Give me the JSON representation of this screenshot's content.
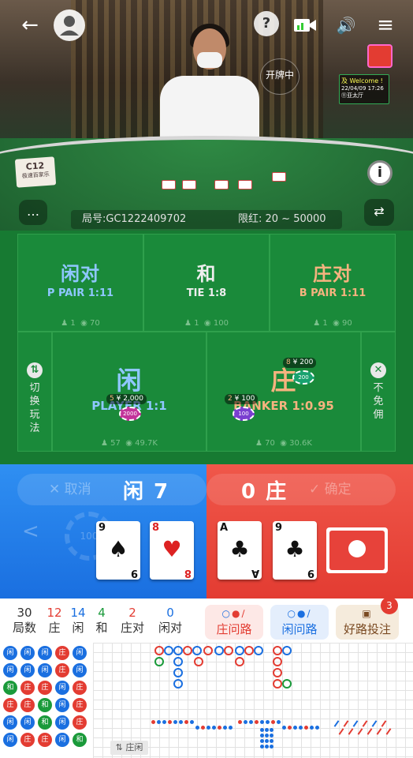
{
  "header": {
    "dealing_label": "开牌中",
    "welcome_line1": "及 Welcome !",
    "welcome_line2": "22/04/09  17:26",
    "welcome_line3": "⑪亚太厅"
  },
  "table_sign": {
    "code": "C12",
    "name": "极速百家乐"
  },
  "round_bar": {
    "round": "局号:GC1222409702",
    "limit": "限红: 20 ~ 50000"
  },
  "bets": {
    "player_pair": {
      "title": "闲对",
      "odds": "P PAIR 1:11",
      "players": "1",
      "amount": "70"
    },
    "tie": {
      "title": "和",
      "odds": "TIE 1:8",
      "players": "1",
      "amount": "100"
    },
    "banker_pair": {
      "title": "庄对",
      "odds": "B PAIR 1:11",
      "players": "1",
      "amount": "90"
    },
    "player": {
      "title": "闲",
      "odds": "PLAYER 1:1",
      "players": "57",
      "amount": "49.7K",
      "chip_tag": "¥ 2,000",
      "chip_count": "5",
      "chip_value": "2000"
    },
    "banker": {
      "title": "庄",
      "odds": "BANKER 1:0.95",
      "players": "70",
      "amount": "30.6K",
      "chip_tag1": "¥ 200",
      "chip_count1": "8",
      "chip_value1": "200",
      "chip_tag2": "¥ 100",
      "chip_count2": "2",
      "chip_value2": "100"
    },
    "switch_label": "切换玩法",
    "nocomm_label": "不免佣"
  },
  "result": {
    "cancel": "取消",
    "confirm": "确定",
    "player_label": "闲 7",
    "banker_label": "0 庄",
    "player_cards": [
      {
        "rank": "9",
        "suit": "♠",
        "color": "black"
      },
      {
        "rank": "8",
        "suit": "♥",
        "color": "red"
      }
    ],
    "banker_cards": [
      {
        "rank": "A",
        "suit": "♣",
        "color": "black"
      },
      {
        "rank": "9",
        "suit": "♣",
        "color": "black"
      }
    ],
    "faded_chip": "100"
  },
  "stats": [
    {
      "value": "30",
      "label": "局数",
      "color": "#333333"
    },
    {
      "value": "12",
      "label": "庄",
      "color": "#e33c32"
    },
    {
      "value": "14",
      "label": "闲",
      "color": "#1a6fe0"
    },
    {
      "value": "4",
      "label": "和",
      "color": "#1a9a3a"
    },
    {
      "value": "2",
      "label": "庄对",
      "color": "#e33c32"
    },
    {
      "value": "0",
      "label": "闲对",
      "color": "#1a6fe0"
    }
  ],
  "road_buttons": {
    "banker_ask": "庄问路",
    "player_ask": "闲问路",
    "good_road": "好路投注",
    "good_road_badge": "3"
  },
  "roads": {
    "bead_rows": [
      [
        "闲",
        "闲",
        "闲",
        "庄",
        "闲"
      ],
      [
        "闲",
        "闲",
        "闲",
        "庄",
        "闲"
      ],
      [
        "和",
        "庄",
        "庄",
        "闲",
        "庄"
      ],
      [
        "庄",
        "庄",
        "和",
        "闲",
        "庄"
      ],
      [
        "闲",
        "闲",
        "和",
        "闲",
        "庄"
      ],
      [
        "闲",
        "庄",
        "庄",
        "闲",
        "和"
      ]
    ],
    "ask_label": "⇅ 庄闲"
  },
  "colors": {
    "player": "#1a6fe0",
    "banker": "#e33c32",
    "tie": "#1a9a3a"
  }
}
